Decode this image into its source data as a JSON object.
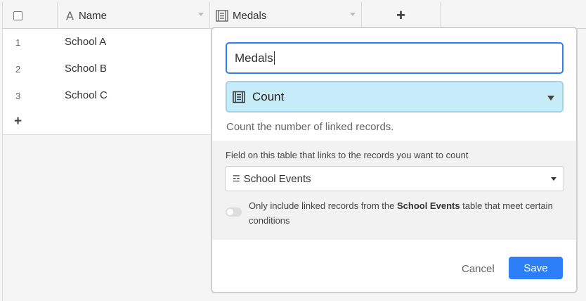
{
  "columns": {
    "name_label": "Name",
    "medals_label": "Medals",
    "add_column_label": "+"
  },
  "rows": [
    {
      "num": "1",
      "name": "School A"
    },
    {
      "num": "2",
      "name": "School B"
    },
    {
      "num": "3",
      "name": "School C"
    }
  ],
  "add_row_label": "+",
  "field_editor": {
    "name_value": "Medals",
    "type_label": "Count",
    "description": "Count the number of linked records.",
    "link_field_label": "Field on this table that links to the records you want to count",
    "link_field_value": "School Events",
    "condition_prefix": "Only include linked records from the ",
    "condition_table": "School Events",
    "condition_suffix": " table that meet certain conditions",
    "condition_enabled": false,
    "cancel_label": "Cancel",
    "save_label": "Save"
  },
  "colors": {
    "accent": "#2d7ff9",
    "type_bg": "#c7ecf9"
  },
  "icons": {
    "name_field": "text-field-icon",
    "medals_field": "count-field-icon",
    "link_field": "link-field-icon"
  }
}
